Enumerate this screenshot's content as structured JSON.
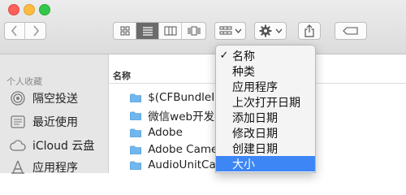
{
  "toolbar": {
    "window_controls": [
      "close",
      "minimize",
      "zoom"
    ],
    "nav": {
      "back_icon": "chevron-left-icon",
      "forward_icon": "chevron-right-icon"
    },
    "view_modes": [
      {
        "name": "icon-view",
        "icon": "grid-icon",
        "active": false
      },
      {
        "name": "list-view",
        "icon": "list-icon",
        "active": true
      },
      {
        "name": "column-view",
        "icon": "columns-icon",
        "active": false
      },
      {
        "name": "cover-flow-view",
        "icon": "cover-flow-icon",
        "active": false
      }
    ],
    "arrange_icon": "arrange-grid-icon",
    "action_icon": "gear-icon",
    "share_icon": "share-icon",
    "tag_icon": "tag-icon",
    "dropdown_icon": "chevron-down-icon"
  },
  "sidebar": {
    "section_title": "个人收藏",
    "items": [
      {
        "label": "隔空投送",
        "icon": "airdrop-icon"
      },
      {
        "label": "最近使用",
        "icon": "clock-icon"
      },
      {
        "label": "iCloud 云盘",
        "icon": "cloud-icon"
      },
      {
        "label": "应用程序",
        "icon": "applications-icon"
      }
    ]
  },
  "file_list": {
    "column_header": "名称",
    "files": [
      {
        "name": "$(CFBundleIde"
      },
      {
        "name": "微信web开发者"
      },
      {
        "name": "Adobe"
      },
      {
        "name": "Adobe Camera"
      },
      {
        "name": "AudioUnitCach"
      }
    ]
  },
  "arrange_menu": {
    "checkmark": "✓",
    "items": [
      {
        "label": "名称",
        "checked": true,
        "highlighted": false
      },
      {
        "label": "种类",
        "checked": false,
        "highlighted": false
      },
      {
        "label": "应用程序",
        "checked": false,
        "highlighted": false
      },
      {
        "label": "上次打开日期",
        "checked": false,
        "highlighted": false
      },
      {
        "label": "添加日期",
        "checked": false,
        "highlighted": false
      },
      {
        "label": "修改日期",
        "checked": false,
        "highlighted": false
      },
      {
        "label": "创建日期",
        "checked": false,
        "highlighted": false
      },
      {
        "label": "大小",
        "checked": false,
        "highlighted": true
      }
    ]
  },
  "colors": {
    "highlight": "#3d86f5",
    "folder": "#6fb7ee",
    "sidebar_bg": "#e6e6e6",
    "toolbar_bg": "#dcdcdc"
  }
}
